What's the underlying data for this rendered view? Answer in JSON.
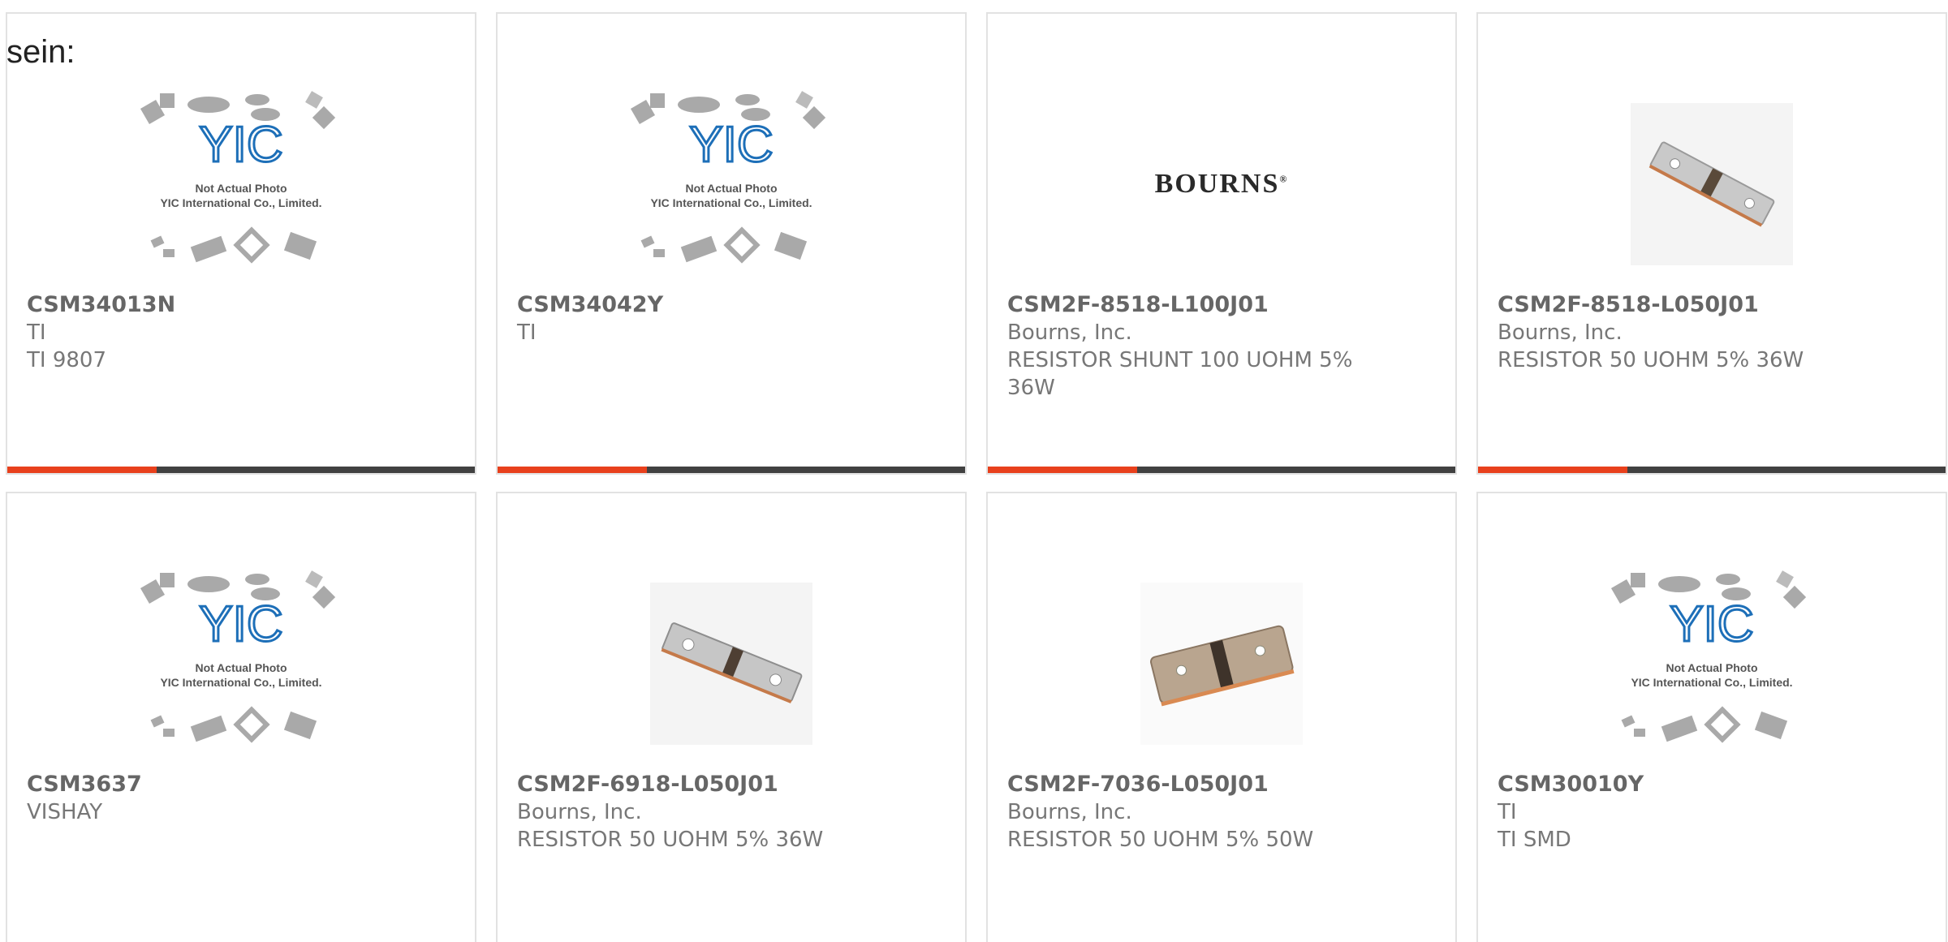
{
  "intro_text": "sein:",
  "placeholder": {
    "line1": "Not Actual Photo",
    "line2": "YIC International Co., Limited.",
    "logo": "YIC"
  },
  "bourns_logo": "BOURNS",
  "accent_color": "#e8401c",
  "bar_color": "#414141",
  "products": [
    {
      "part": "CSM34013N",
      "maker": "TI",
      "desc": "TI 9807",
      "image": "placeholder-yic"
    },
    {
      "part": "CSM34042Y",
      "maker": "TI",
      "desc": "",
      "image": "placeholder-yic"
    },
    {
      "part": "CSM2F-8518-L100J01",
      "maker": "Bourns, Inc.",
      "desc": "RESISTOR SHUNT 100 UOHM 5% 36W",
      "image": "bourns-logo"
    },
    {
      "part": "CSM2F-8518-L050J01",
      "maker": "Bourns, Inc.",
      "desc": "RESISTOR 50 UOHM 5% 36W",
      "image": "shunt-resistor-photo"
    },
    {
      "part": "CSM3637",
      "maker": "VISHAY",
      "desc": "",
      "image": "placeholder-yic"
    },
    {
      "part": "CSM2F-6918-L050J01",
      "maker": "Bourns, Inc.",
      "desc": "RESISTOR 50 UOHM 5% 36W",
      "image": "shunt-resistor-photo"
    },
    {
      "part": "CSM2F-7036-L050J01",
      "maker": "Bourns, Inc.",
      "desc": "RESISTOR 50 UOHM 5% 50W",
      "image": "copper-shunt-photo"
    },
    {
      "part": "CSM30010Y",
      "maker": "TI",
      "desc": "TI SMD",
      "image": "placeholder-yic"
    }
  ]
}
